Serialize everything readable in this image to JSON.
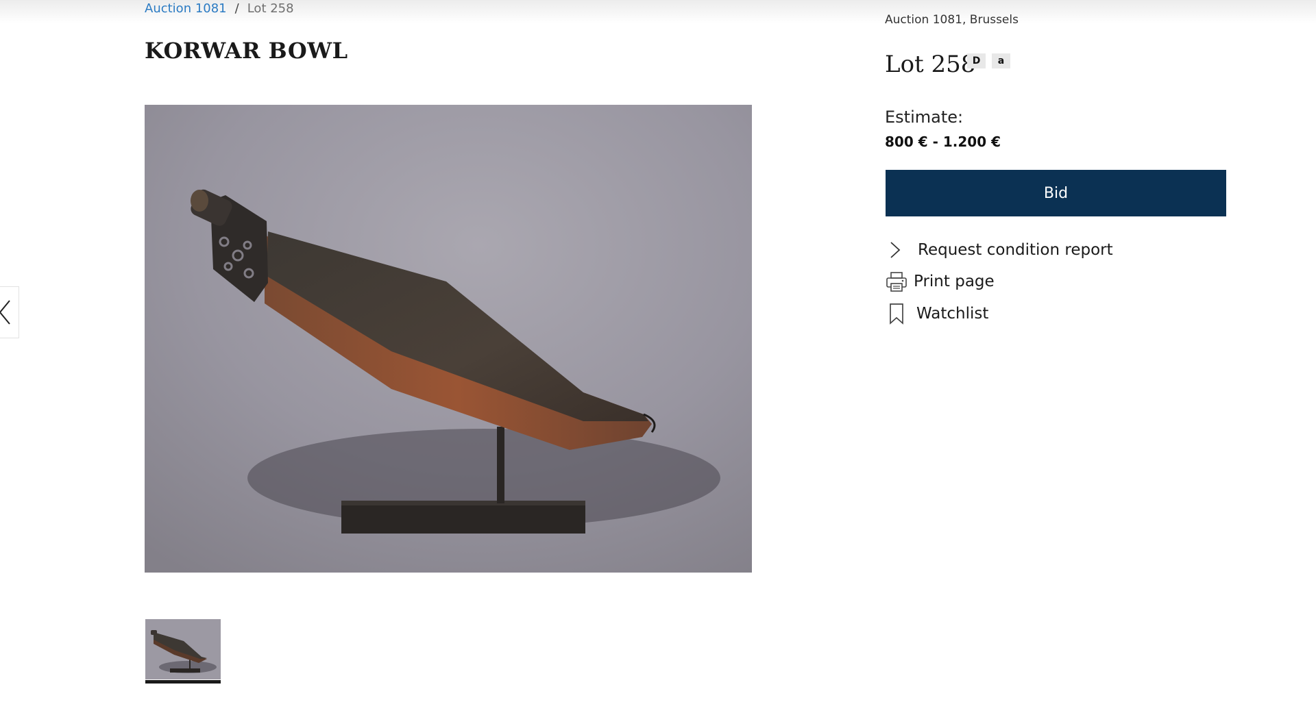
{
  "breadcrumb": {
    "auction_link": "Auction 1081",
    "separator": "/",
    "current": "Lot 258"
  },
  "lot": {
    "title": "KORWAR BOWL",
    "auction_location": "Auction 1081, Brussels",
    "number_label": "Lot 258",
    "badges": [
      "D",
      "a"
    ]
  },
  "estimate": {
    "label": "Estimate:",
    "value": "800 € - 1.200 €"
  },
  "actions": {
    "bid_label": "Bid",
    "condition_report_label": "Request condition report",
    "print_label": "Print page",
    "watchlist_label": "Watchlist"
  },
  "gallery": {
    "image_count": 1,
    "selected_index": 0
  },
  "icons": {
    "prev": "chevron-left-icon",
    "condition": "chevron-right-icon",
    "print": "printer-icon",
    "watchlist": "bookmark-icon"
  },
  "colors": {
    "link": "#2b7bc3",
    "bid_button": "#0b3153",
    "badge_bg": "#e8e8e8"
  }
}
